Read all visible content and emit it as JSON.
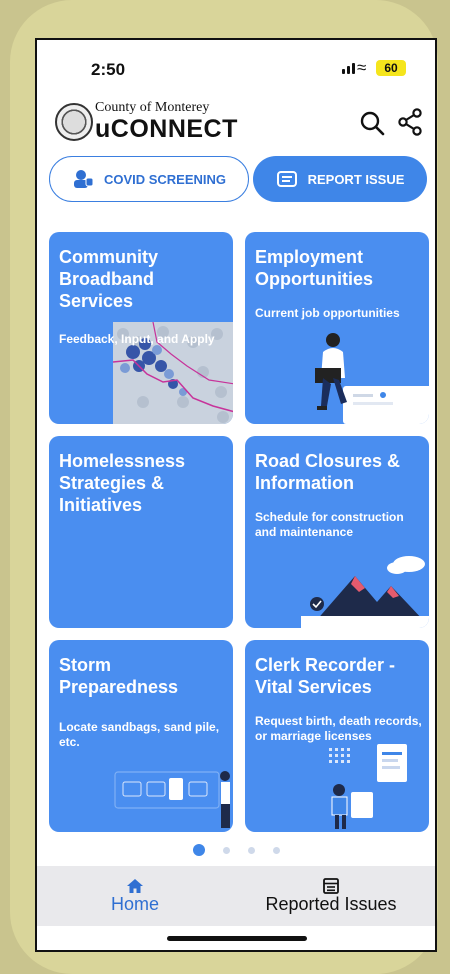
{
  "status_bar": {
    "time": "2:50",
    "battery": "60",
    "icons": [
      "signal-icon",
      "wifi-icon",
      "battery-icon"
    ]
  },
  "header": {
    "county": "County of Monterey",
    "brand": "uCONNECT",
    "icons": [
      "county-seal",
      "search-icon",
      "share-icon"
    ]
  },
  "actions": {
    "covid_label": "COVID SCREENING",
    "report_label": "REPORT ISSUE"
  },
  "tiles": [
    {
      "title": "Community Broadband Services",
      "subtitle": "Feedback, Input, and Apply"
    },
    {
      "title": "Employment Opportunities",
      "subtitle": "Current job opportunities"
    },
    {
      "title": "Homelessness Strategies & Initiatives",
      "subtitle": ""
    },
    {
      "title": "Road Closures & Information",
      "subtitle": "Schedule for construction and maintenance"
    },
    {
      "title": "Storm Preparedness",
      "subtitle": "Locate sandbags, sand pile, etc."
    },
    {
      "title": "Clerk Recorder - Vital Services",
      "subtitle": "Request birth, death records, or marriage licenses"
    }
  ],
  "pager": {
    "pages": 4,
    "active": 1
  },
  "tabbar": {
    "home_label": "Home",
    "reported_label": "Reported Issues"
  },
  "colors": {
    "accent": "#3f86e8",
    "tile": "#4a8ef0",
    "tabbar": "#e9e9ec"
  }
}
